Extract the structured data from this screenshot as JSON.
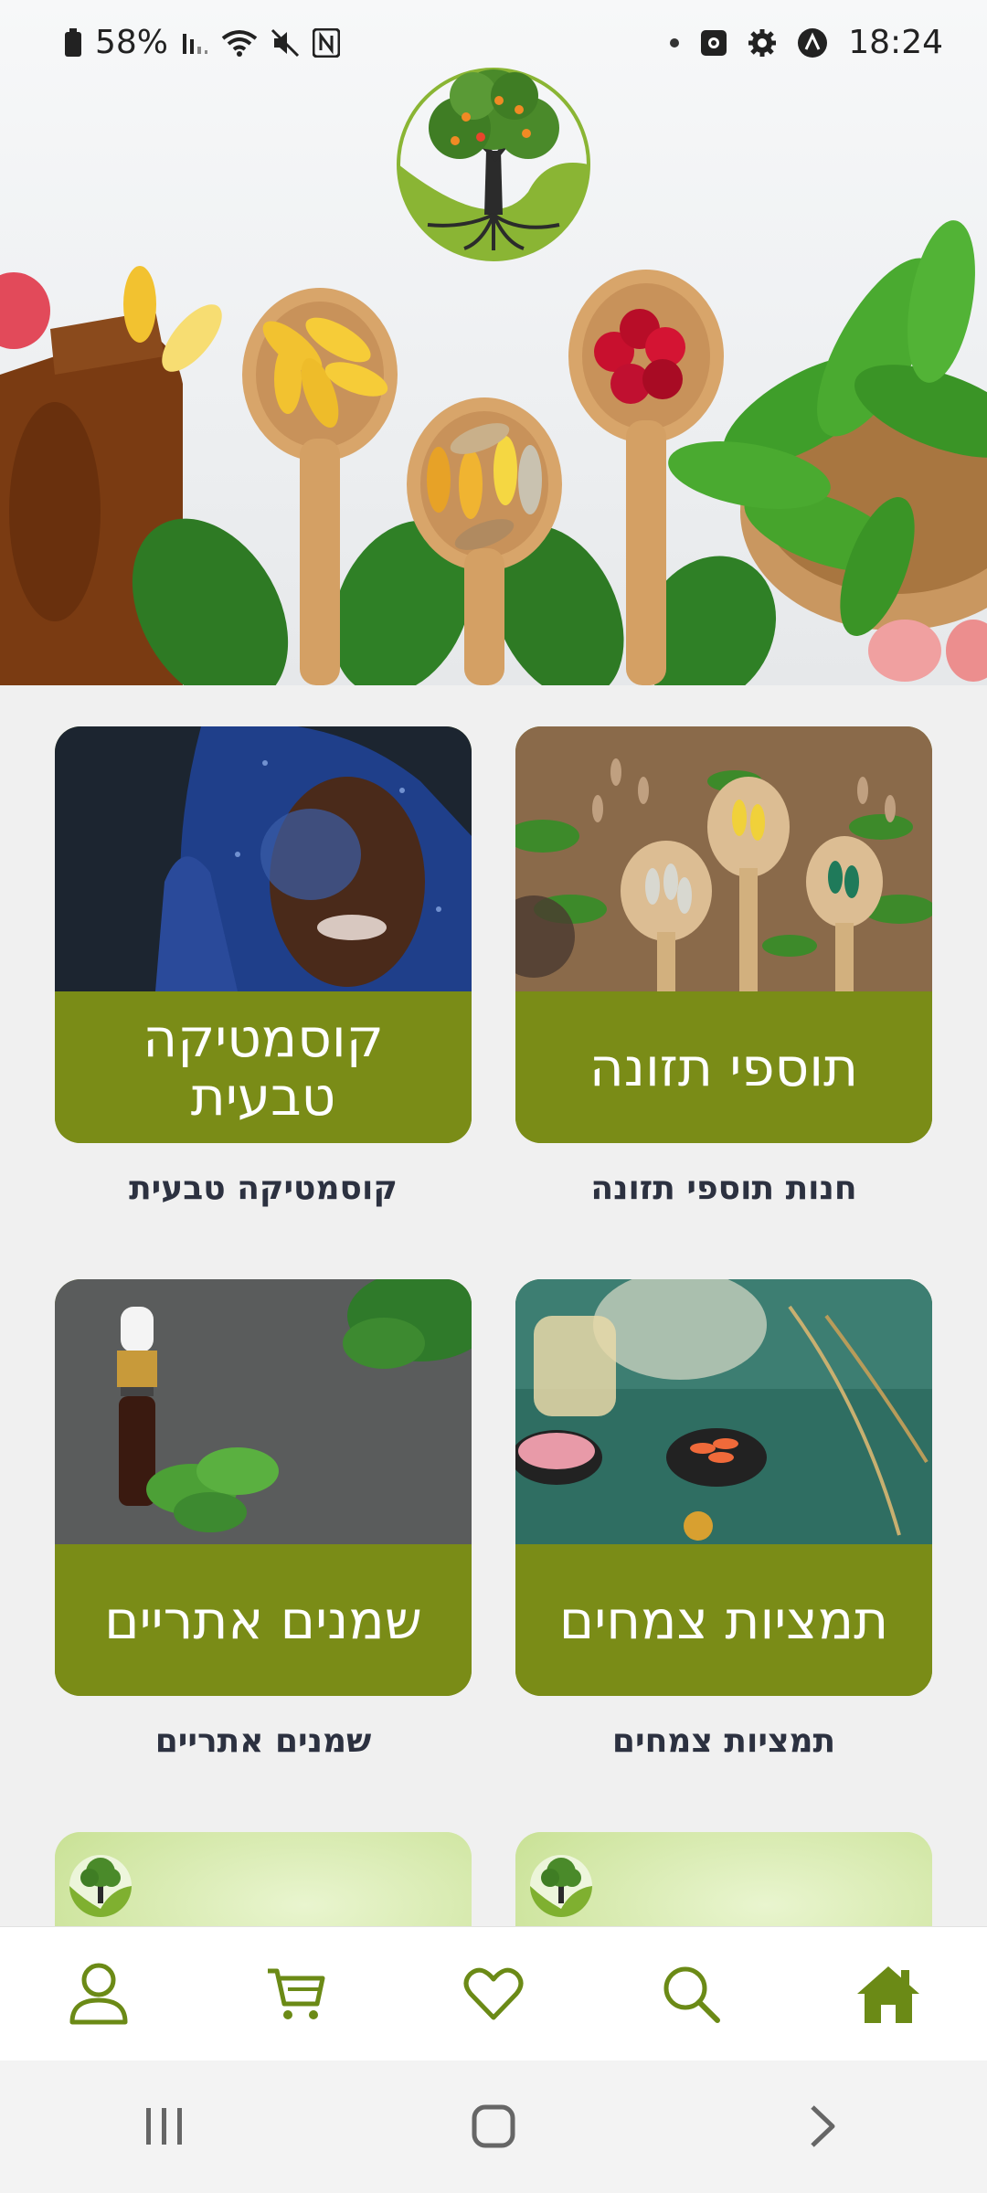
{
  "status_bar": {
    "battery": "58%",
    "time": "18:24",
    "left_icons": [
      "battery-icon",
      "signal-icon",
      "wifi-icon",
      "mute-icon",
      "nfc-icon"
    ],
    "right_icons": [
      "dot-icon",
      "screen-record-icon",
      "settings-icon",
      "app-notification-icon"
    ]
  },
  "brand": {
    "logo": "tree-of-life-logo"
  },
  "categories": [
    {
      "band_label": "תוספי תזונה",
      "caption": "חנות תוספי תזונה",
      "image": "supplements-spoons-photo"
    },
    {
      "band_label": "קוסמטיקה טבעית",
      "caption": "קוסמטיקה טבעית",
      "image": "glitter-face-photo"
    },
    {
      "band_label": "תמציות צמחים",
      "caption": "תמציות צמחים",
      "image": "herbal-extracts-photo"
    },
    {
      "band_label": "שמנים אתריים",
      "caption": "שמנים אתריים",
      "image": "essential-oil-mint-photo"
    }
  ],
  "bottom_nav": {
    "items": [
      "home-icon",
      "search-icon",
      "heart-icon",
      "cart-icon",
      "user-icon"
    ],
    "active": "home-icon"
  },
  "colors": {
    "accent": "#7a8c17",
    "nav_icon": "#6b8a16",
    "caption_text": "#2c3140",
    "page_bg": "#f0f0f0"
  }
}
